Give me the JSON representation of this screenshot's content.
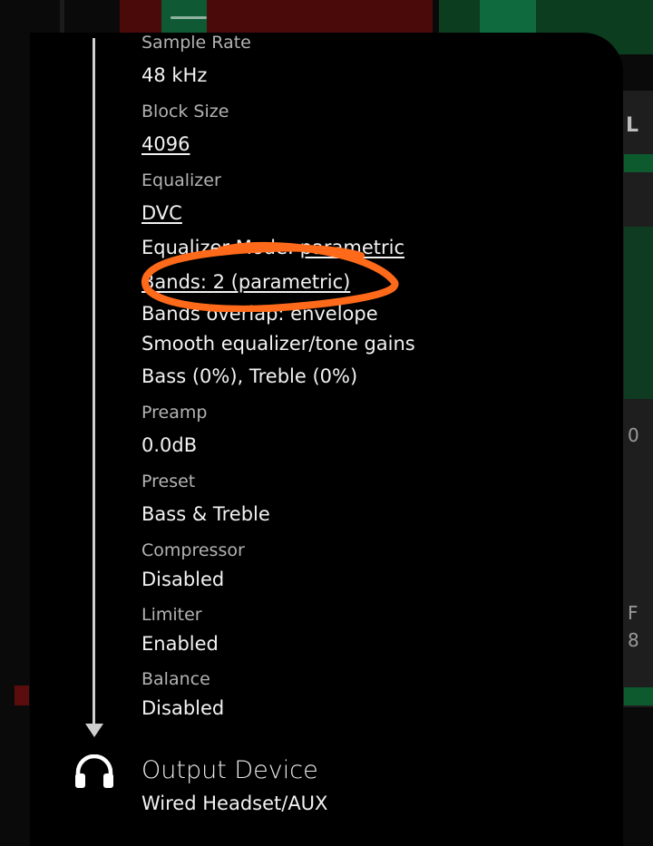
{
  "settings": [
    {
      "label": "Sample Rate",
      "value": "48 kHz"
    },
    {
      "label": "Block Size",
      "value": "4096"
    },
    {
      "label": "Equalizer",
      "value": "DVC"
    }
  ],
  "equalizer": {
    "mode_prefix": "Equalizer Mode: ",
    "mode_value": "parametric",
    "bands": "Bands: 2 (parametric)",
    "overlap": "Bands overlap: envelope",
    "smooth": "Smooth equalizer/tone gains",
    "bass_treble": "Bass (0%), Treble (0%)"
  },
  "preamp": {
    "label": "Preamp",
    "value": "0.0dB"
  },
  "preset": {
    "label": "Preset",
    "value": "Bass & Treble"
  },
  "compressor": {
    "label": "Compressor",
    "value": "Disabled"
  },
  "limiter": {
    "label": "Limiter",
    "value": "Enabled"
  },
  "balance": {
    "label": "Balance",
    "value": "Disabled"
  },
  "output": {
    "title": "Output Device",
    "value": "Wired Headset/AUX",
    "icon": "headphones-icon"
  },
  "background": {
    "char_l": "L",
    "char_0": "0",
    "char_f": "F",
    "char_8": "8"
  },
  "colors": {
    "scribble": "#ff6a1a",
    "background": "#000000"
  }
}
